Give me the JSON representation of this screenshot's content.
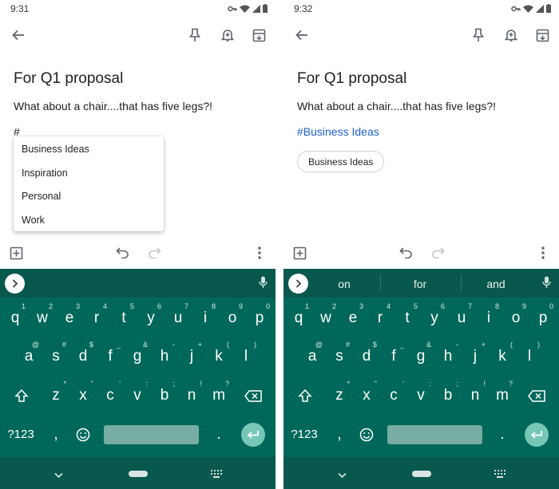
{
  "screens": [
    {
      "status_time": "9:31",
      "note": {
        "title": "For Q1 proposal",
        "body": "What about a chair....that has five legs?!",
        "typed": "#"
      },
      "label_menu": [
        "Business Ideas",
        "Inspiration",
        "Personal",
        "Work"
      ],
      "keyboard": {
        "suggestions": []
      }
    },
    {
      "status_time": "9:32",
      "note": {
        "title": "For Q1 proposal",
        "body": "What about a chair....that has five legs?!",
        "hashtag": "#Business Ideas",
        "label_chip": "Business Ideas"
      },
      "keyboard": {
        "suggestions": [
          "on",
          "for",
          "and"
        ]
      }
    }
  ],
  "keyboard": {
    "row1": [
      "q",
      "w",
      "e",
      "r",
      "t",
      "y",
      "u",
      "i",
      "o",
      "p"
    ],
    "row1_hints": [
      "1",
      "2",
      "3",
      "4",
      "5",
      "6",
      "7",
      "8",
      "9",
      "0"
    ],
    "row2": [
      "a",
      "s",
      "d",
      "f",
      "g",
      "h",
      "j",
      "k",
      "l"
    ],
    "row2_hints": [
      "@",
      "#",
      "$",
      "_",
      "&",
      "-",
      "+",
      "(",
      ")"
    ],
    "row3": [
      "z",
      "x",
      "c",
      "v",
      "b",
      "n",
      "m"
    ],
    "row3_hints": [
      "*",
      "\"",
      "'",
      ":",
      ";",
      "!",
      "?"
    ],
    "symbols_label": "?123",
    "comma": ",",
    "period": "."
  },
  "icons": {
    "back": "arrow-left-icon",
    "pin": "pin-icon",
    "reminder": "bell-plus-icon",
    "archive": "archive-icon",
    "add": "add-box-icon",
    "undo": "undo-icon",
    "redo": "redo-icon",
    "more": "more-vert-icon",
    "mic": "mic-icon",
    "shift": "shift-icon",
    "backspace": "backspace-icon",
    "emoji": "emoji-icon",
    "enter": "enter-icon"
  },
  "colors": {
    "keyboard_bg": "#00685a",
    "keyboard_top": "#09584d",
    "link": "#1a5fd0",
    "enter_key": "#77c7b7"
  }
}
